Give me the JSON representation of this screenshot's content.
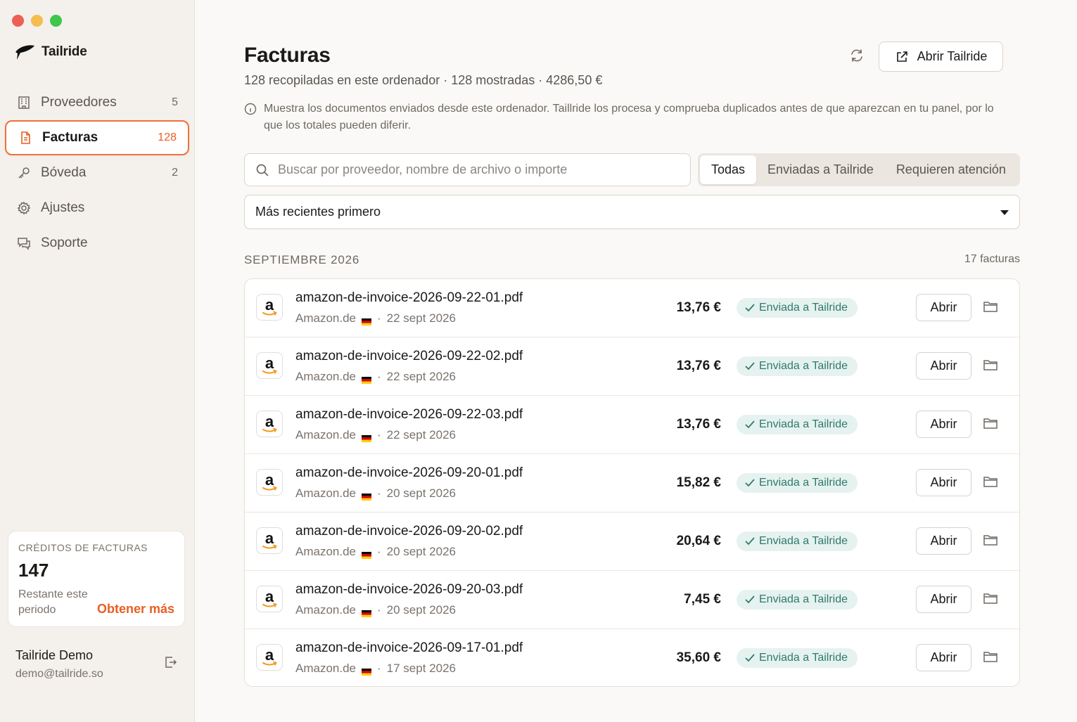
{
  "app": {
    "name": "Tailride"
  },
  "sidebar": {
    "items": [
      {
        "label": "Proveedores",
        "count": "5",
        "icon": "building-icon"
      },
      {
        "label": "Facturas",
        "count": "128",
        "icon": "document-icon",
        "active": true
      },
      {
        "label": "Bóveda",
        "count": "2",
        "icon": "key-icon"
      },
      {
        "label": "Ajustes",
        "count": "",
        "icon": "gear-icon"
      },
      {
        "label": "Soporte",
        "count": "",
        "icon": "chat-icon"
      }
    ],
    "credits": {
      "title": "CRÉDITOS DE FACTURAS",
      "value": "147",
      "remaining": "Restante este periodo",
      "cta": "Obtener más"
    },
    "user": {
      "name": "Tailride Demo",
      "email": "demo@tailride.so"
    }
  },
  "header": {
    "title": "Facturas",
    "subtitle": "128 recopiladas en este ordenador · 128 mostradas · 4286,50 €",
    "open_button": "Abrir Tailride",
    "info": "Muestra los documentos enviados desde este ordenador. Taillride los procesa y comprueba duplicados antes de que aparezcan en tu panel, por lo que los totales pueden diferir."
  },
  "search": {
    "placeholder": "Buscar por proveedor, nombre de archivo o importe",
    "value": ""
  },
  "filters": {
    "tabs": [
      "Todas",
      "Enviadas a Tailride",
      "Requieren atención"
    ],
    "selected": "Todas"
  },
  "sort": {
    "selected": "Más recientes primero"
  },
  "group": {
    "title": "SEPTIEMBRE 2026",
    "count": "17 facturas"
  },
  "colors": {
    "accent": "#e85f22",
    "status_bg": "#e6f2ef",
    "status_fg": "#2f7a6b"
  },
  "invoices": [
    {
      "file": "amazon-de-invoice-2026-09-22-01.pdf",
      "vendor": "Amazon.de",
      "date": "22 sept 2026",
      "amount": "13,76 €",
      "status": "Enviada a Tailride",
      "action": "Abrir"
    },
    {
      "file": "amazon-de-invoice-2026-09-22-02.pdf",
      "vendor": "Amazon.de",
      "date": "22 sept 2026",
      "amount": "13,76 €",
      "status": "Enviada a Tailride",
      "action": "Abrir"
    },
    {
      "file": "amazon-de-invoice-2026-09-22-03.pdf",
      "vendor": "Amazon.de",
      "date": "22 sept 2026",
      "amount": "13,76 €",
      "status": "Enviada a Tailride",
      "action": "Abrir"
    },
    {
      "file": "amazon-de-invoice-2026-09-20-01.pdf",
      "vendor": "Amazon.de",
      "date": "20 sept 2026",
      "amount": "15,82 €",
      "status": "Enviada a Tailride",
      "action": "Abrir"
    },
    {
      "file": "amazon-de-invoice-2026-09-20-02.pdf",
      "vendor": "Amazon.de",
      "date": "20 sept 2026",
      "amount": "20,64 €",
      "status": "Enviada a Tailride",
      "action": "Abrir"
    },
    {
      "file": "amazon-de-invoice-2026-09-20-03.pdf",
      "vendor": "Amazon.de",
      "date": "20 sept 2026",
      "amount": "7,45 €",
      "status": "Enviada a Tailride",
      "action": "Abrir"
    },
    {
      "file": "amazon-de-invoice-2026-09-17-01.pdf",
      "vendor": "Amazon.de",
      "date": "17 sept 2026",
      "amount": "35,60 €",
      "status": "Enviada a Tailride",
      "action": "Abrir"
    }
  ]
}
